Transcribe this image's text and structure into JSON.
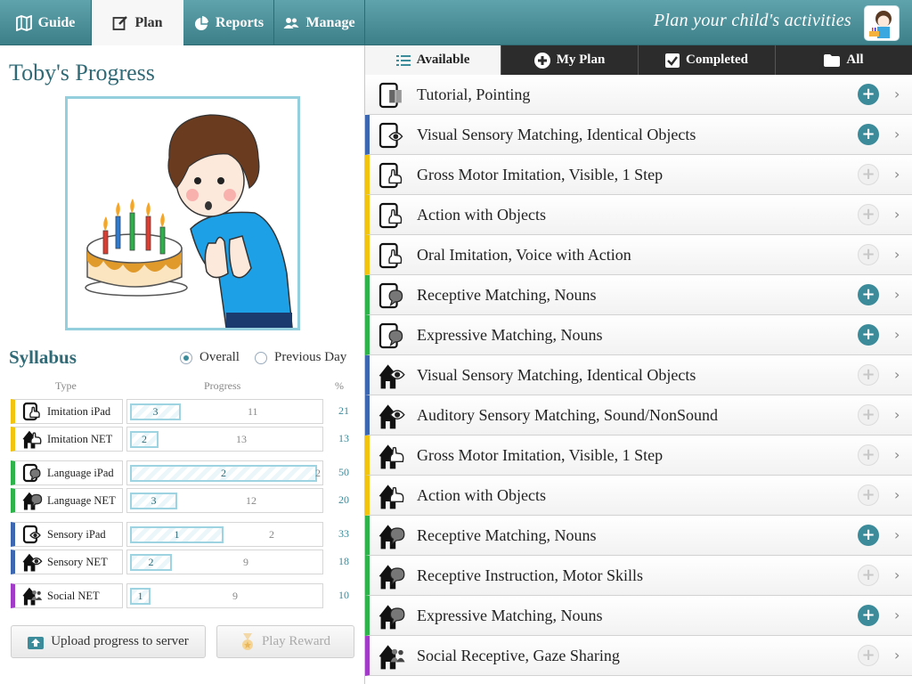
{
  "topbar": {
    "tabs": [
      {
        "label": "Guide",
        "icon": "map-icon"
      },
      {
        "label": "Plan",
        "icon": "edit-icon",
        "active": true
      },
      {
        "label": "Reports",
        "icon": "pie-chart-icon"
      },
      {
        "label": "Manage",
        "icon": "users-icon"
      }
    ],
    "tagline": "Plan your child's activities"
  },
  "left": {
    "title": "Toby's Progress",
    "syllabus": {
      "title": "Syllabus",
      "options": [
        {
          "label": "Overall",
          "selected": true
        },
        {
          "label": "Previous Day",
          "selected": false
        }
      ],
      "headers": {
        "type": "Type",
        "progress": "Progress",
        "percent": "%"
      },
      "rows": [
        {
          "type": "Imitation iPad",
          "done": "3",
          "total": "11",
          "pct": "21",
          "color": "#f2c40f",
          "icon": "tablet-hand-icon"
        },
        {
          "type": "Imitation NET",
          "done": "2",
          "total": "13",
          "pct": "13",
          "color": "#f2c40f",
          "icon": "house-hand-icon"
        },
        {
          "type": "Language iPad",
          "done": "2",
          "total": "2",
          "pct": "50",
          "color": "#2db34a",
          "icon": "tablet-speech-icon"
        },
        {
          "type": "Language NET",
          "done": "3",
          "total": "12",
          "pct": "20",
          "color": "#2db34a",
          "icon": "house-speech-icon"
        },
        {
          "type": "Sensory iPad",
          "done": "1",
          "total": "2",
          "pct": "33",
          "color": "#3d67b1",
          "icon": "tablet-eye-icon"
        },
        {
          "type": "Sensory NET",
          "done": "2",
          "total": "9",
          "pct": "18",
          "color": "#3d67b1",
          "icon": "house-eye-icon"
        },
        {
          "type": "Social NET",
          "done": "1",
          "total": "9",
          "pct": "10",
          "color": "#a23cc8",
          "icon": "house-people-icon"
        }
      ]
    },
    "buttons": {
      "upload": "Upload progress to server",
      "reward": "Play Reward"
    }
  },
  "right": {
    "filters": [
      {
        "label": "Available",
        "icon": "list-icon",
        "active": true
      },
      {
        "label": "My Plan",
        "icon": "plus-circle-icon"
      },
      {
        "label": "Completed",
        "icon": "checkbox-icon"
      },
      {
        "label": "All",
        "icon": "folder-icon"
      }
    ],
    "activities": [
      {
        "label": "Tutorial, Pointing",
        "icon": "tablet-book-icon",
        "color": "",
        "added": true
      },
      {
        "label": "Visual Sensory Matching, Identical Objects",
        "icon": "tablet-eye-icon",
        "color": "#3d67b1",
        "added": true
      },
      {
        "label": "Gross Motor Imitation, Visible, 1 Step",
        "icon": "tablet-hand-icon",
        "color": "#f2c40f",
        "added": false
      },
      {
        "label": "Action with Objects",
        "icon": "tablet-hand-icon",
        "color": "#f2c40f",
        "added": false
      },
      {
        "label": "Oral Imitation, Voice with Action",
        "icon": "tablet-hand-icon",
        "color": "#f2c40f",
        "added": false
      },
      {
        "label": "Receptive Matching, Nouns",
        "icon": "tablet-speech-icon",
        "color": "#2db34a",
        "added": true
      },
      {
        "label": "Expressive Matching, Nouns",
        "icon": "tablet-speech-icon",
        "color": "#2db34a",
        "added": true
      },
      {
        "label": "Visual Sensory Matching, Identical Objects",
        "icon": "house-eye-icon",
        "color": "#3d67b1",
        "added": false
      },
      {
        "label": "Auditory Sensory Matching, Sound/NonSound",
        "icon": "house-eye-icon",
        "color": "#3d67b1",
        "added": false
      },
      {
        "label": "Gross Motor Imitation, Visible, 1 Step",
        "icon": "house-hand-icon",
        "color": "#f2c40f",
        "added": false
      },
      {
        "label": "Action with Objects",
        "icon": "house-hand-icon",
        "color": "#f2c40f",
        "added": false
      },
      {
        "label": "Receptive Matching, Nouns",
        "icon": "house-speech-icon",
        "color": "#2db34a",
        "added": true
      },
      {
        "label": "Receptive Instruction, Motor Skills",
        "icon": "house-speech-icon",
        "color": "#2db34a",
        "added": false
      },
      {
        "label": "Expressive Matching, Nouns",
        "icon": "house-speech-icon",
        "color": "#2db34a",
        "added": true
      },
      {
        "label": "Social Receptive, Gaze Sharing",
        "icon": "house-people-icon",
        "color": "#a23cc8",
        "added": false
      }
    ]
  }
}
